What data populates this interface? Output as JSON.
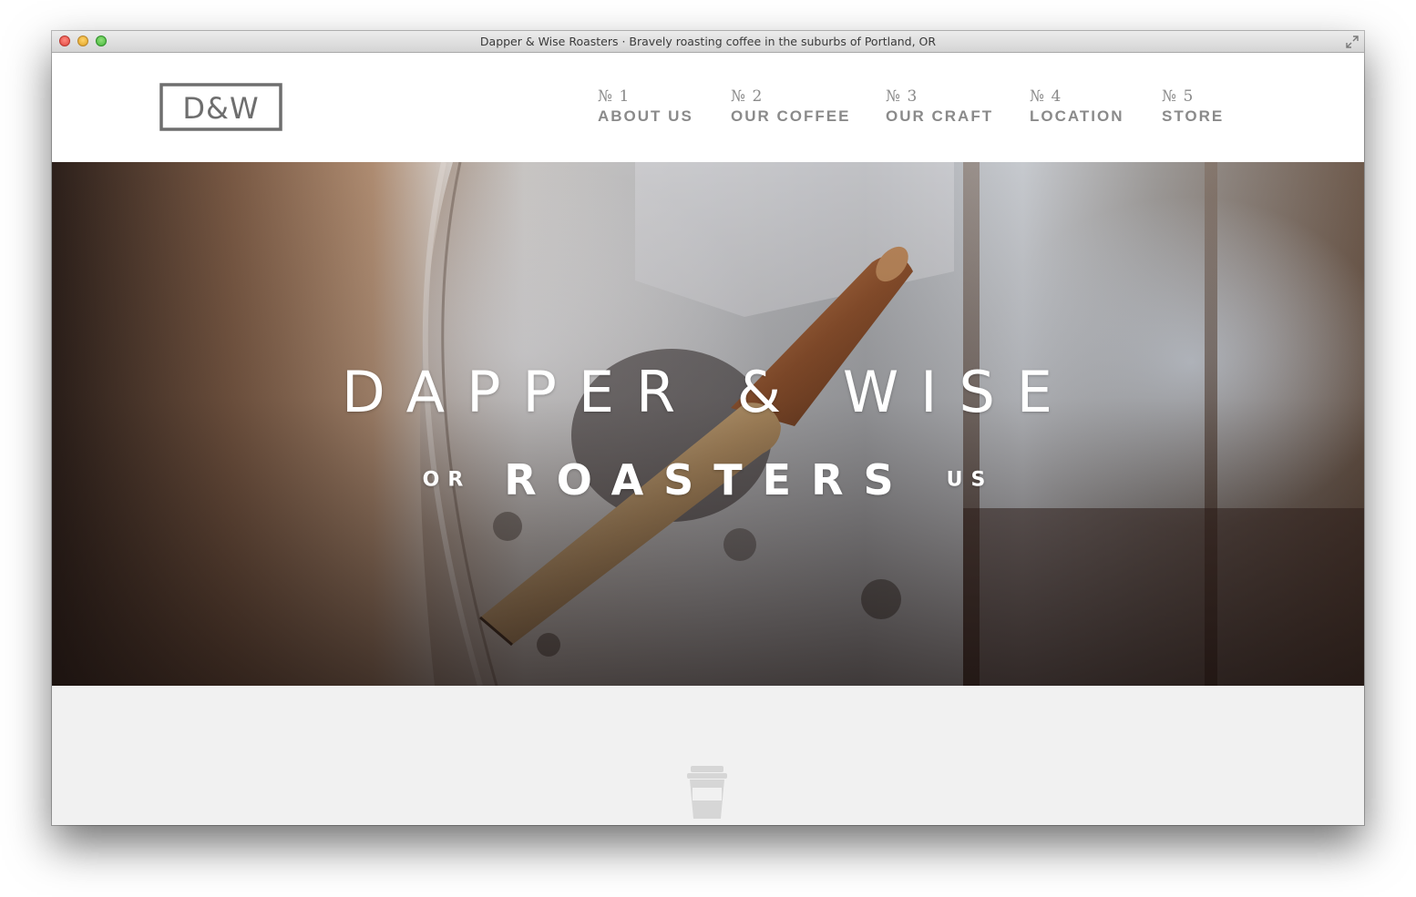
{
  "window": {
    "title": "Dapper & Wise Roasters · Bravely roasting coffee in the suburbs of Portland, OR"
  },
  "logo": {
    "text": "D&W",
    "icon": "dw-monogram-logo"
  },
  "nav": {
    "items": [
      {
        "number": "№ 1",
        "label": "ABOUT US"
      },
      {
        "number": "№ 2",
        "label": "OUR COFFEE"
      },
      {
        "number": "№ 3",
        "label": "OUR CRAFT"
      },
      {
        "number": "№ 4",
        "label": "LOCATION"
      },
      {
        "number": "№ 5",
        "label": "STORE"
      }
    ]
  },
  "hero": {
    "title": "DAPPER & WISE",
    "sub_left": "OR",
    "sub_main": "ROASTERS",
    "sub_right": "US",
    "image": "coffee-roaster-photo"
  },
  "lower": {
    "icon": "coffee-cup-icon"
  },
  "colors": {
    "nav_text": "#8a8a8a",
    "logo": "#6e6e6e",
    "lower_bg": "#f1f1f1",
    "cup_icon": "#d6d6d6"
  }
}
